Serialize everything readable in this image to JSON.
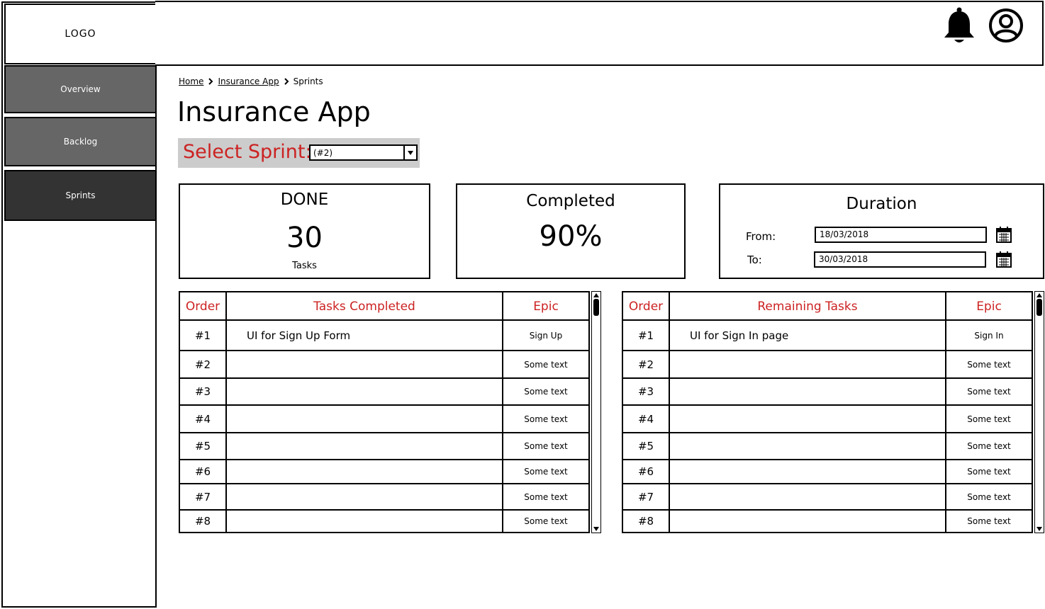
{
  "sidebar": {
    "logo": "LOGO",
    "items": [
      {
        "label": "Overview"
      },
      {
        "label": "Backlog"
      },
      {
        "label": "Sprints"
      }
    ]
  },
  "header": {
    "icons": [
      "bell-icon",
      "user-avatar-icon"
    ]
  },
  "breadcrumb": {
    "items": [
      "Home",
      "Insurance App",
      "Sprints"
    ]
  },
  "page": {
    "title": "Insurance App"
  },
  "sprint_select": {
    "label": "Select Sprint:",
    "value": "(#2)"
  },
  "cards": {
    "done": {
      "title": "DONE",
      "value": "30",
      "caption": "Tasks"
    },
    "completed": {
      "title": "Completed",
      "value": "90%"
    },
    "duration": {
      "title": "Duration",
      "from_label": "From:",
      "from_value": "18/03/2018",
      "to_label": "To:",
      "to_value": "30/03/2018"
    }
  },
  "tables": {
    "completed": {
      "headers": {
        "order": "Order",
        "task": "Tasks Completed",
        "epic": "Epic"
      },
      "rows": [
        {
          "order": "#1",
          "task": "UI for Sign Up Form",
          "epic": "Sign Up"
        },
        {
          "order": "#2",
          "task": "",
          "epic": "Some text"
        },
        {
          "order": "#3",
          "task": "",
          "epic": "Some text"
        },
        {
          "order": "#4",
          "task": "",
          "epic": "Some text"
        },
        {
          "order": "#5",
          "task": "",
          "epic": "Some text"
        },
        {
          "order": "#6",
          "task": "",
          "epic": "Some text"
        },
        {
          "order": "#7",
          "task": "",
          "epic": "Some text"
        },
        {
          "order": "#8",
          "task": "",
          "epic": "Some text"
        }
      ]
    },
    "remaining": {
      "headers": {
        "order": "Order",
        "task": "Remaining Tasks",
        "epic": "Epic"
      },
      "rows": [
        {
          "order": "#1",
          "task": "UI for Sign In page",
          "epic": "Sign In"
        },
        {
          "order": "#2",
          "task": "",
          "epic": "Some text"
        },
        {
          "order": "#3",
          "task": "",
          "epic": "Some text"
        },
        {
          "order": "#4",
          "task": "",
          "epic": "Some text"
        },
        {
          "order": "#5",
          "task": "",
          "epic": "Some text"
        },
        {
          "order": "#6",
          "task": "",
          "epic": "Some text"
        },
        {
          "order": "#7",
          "task": "",
          "epic": "Some text"
        },
        {
          "order": "#8",
          "task": "",
          "epic": "Some text"
        }
      ]
    }
  },
  "colors": {
    "accent_red": "#cc2222",
    "nav_gray": "#666666",
    "nav_active": "#333333",
    "select_bg": "#cccccc"
  }
}
